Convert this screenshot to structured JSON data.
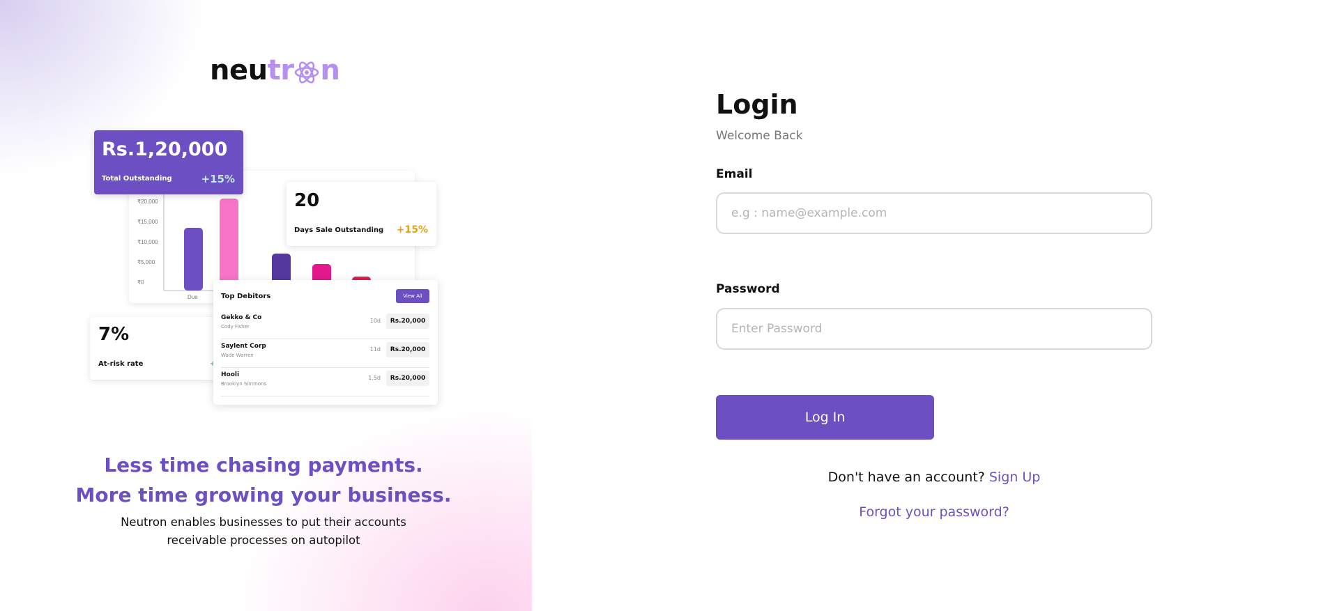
{
  "brand": {
    "logo_part1": "neu",
    "logo_part2": "tr",
    "logo_part3": "n",
    "logo_icon": "atom-icon",
    "primary_color": "#6c4fc2",
    "accent_color": "#b690ee"
  },
  "preview": {
    "outstanding": {
      "amount": "Rs.1,20,000",
      "label": "Total Outstanding",
      "change": "+15%"
    },
    "dso": {
      "value": "20",
      "label": "Days Sale Outstanding",
      "change": "+15%"
    },
    "risk": {
      "value": "7%",
      "label": "At-risk rate"
    },
    "chart": {
      "tick_labels": [
        "₹20,000",
        "₹15,000",
        "₹10,000",
        "₹5,000",
        "₹0"
      ],
      "x_label": "Due"
    },
    "debtors": {
      "title": "Top Debitors",
      "view_all": "View All",
      "rows": [
        {
          "name": "Gekko & Co",
          "contact": "Cody Fisher",
          "days": "10d",
          "amount": "Rs.20,000"
        },
        {
          "name": "Saylent Corp",
          "contact": "Wade Warren",
          "days": "11d",
          "amount": "Rs.20,000"
        },
        {
          "name": "Hooli",
          "contact": "Brooklyn Simmons",
          "days": "1.5d",
          "amount": "Rs.20,000"
        }
      ]
    }
  },
  "marketing": {
    "headline_1": "Less time chasing payments.",
    "headline_2": "More time growing your business.",
    "subtext": "Neutron enables businesses to put their accounts receivable processes on autopilot"
  },
  "login": {
    "title": "Login",
    "subtitle": "Welcome Back",
    "email_label": "Email",
    "email_placeholder": "e.g : name@example.com",
    "password_label": "Password",
    "password_placeholder": "Enter Password",
    "submit_label": "Log In",
    "signup_prompt": "Don't have an account?",
    "signup_link": "Sign Up",
    "forgot_link": "Forgot your password?"
  }
}
